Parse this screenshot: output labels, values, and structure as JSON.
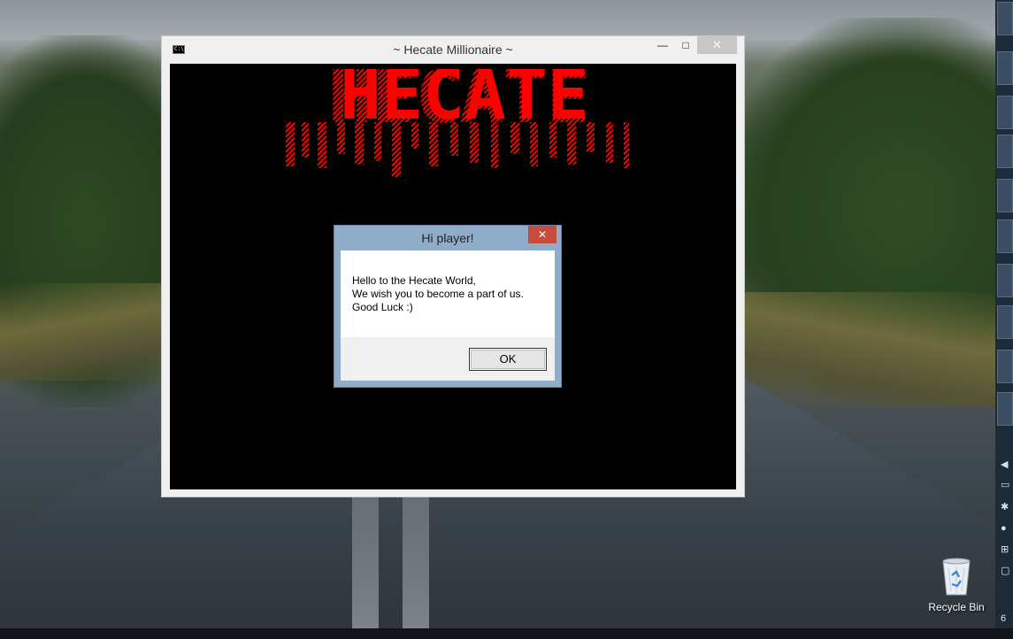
{
  "console_window": {
    "title": "~ Hecate Millionaire ~",
    "icon": "console-icon",
    "icon_text": "C:\\",
    "controls": {
      "minimize": "—",
      "maximize": "□",
      "close": "✕"
    },
    "logo_text": "HECATE",
    "logo_color": "#ff0000",
    "body_color": "#000000"
  },
  "dialog": {
    "title": "Hi player!",
    "close_label": "✕",
    "message_lines": [
      "Hello to the Hecate World,",
      "We wish you to become a part of us.",
      "Good Luck :)"
    ],
    "ok_label": "OK"
  },
  "desktop": {
    "recycle_bin_label": "Recycle Bin",
    "icons": [
      "recycle-bin-icon"
    ]
  },
  "taskbar": {
    "clock_partial": "6"
  }
}
